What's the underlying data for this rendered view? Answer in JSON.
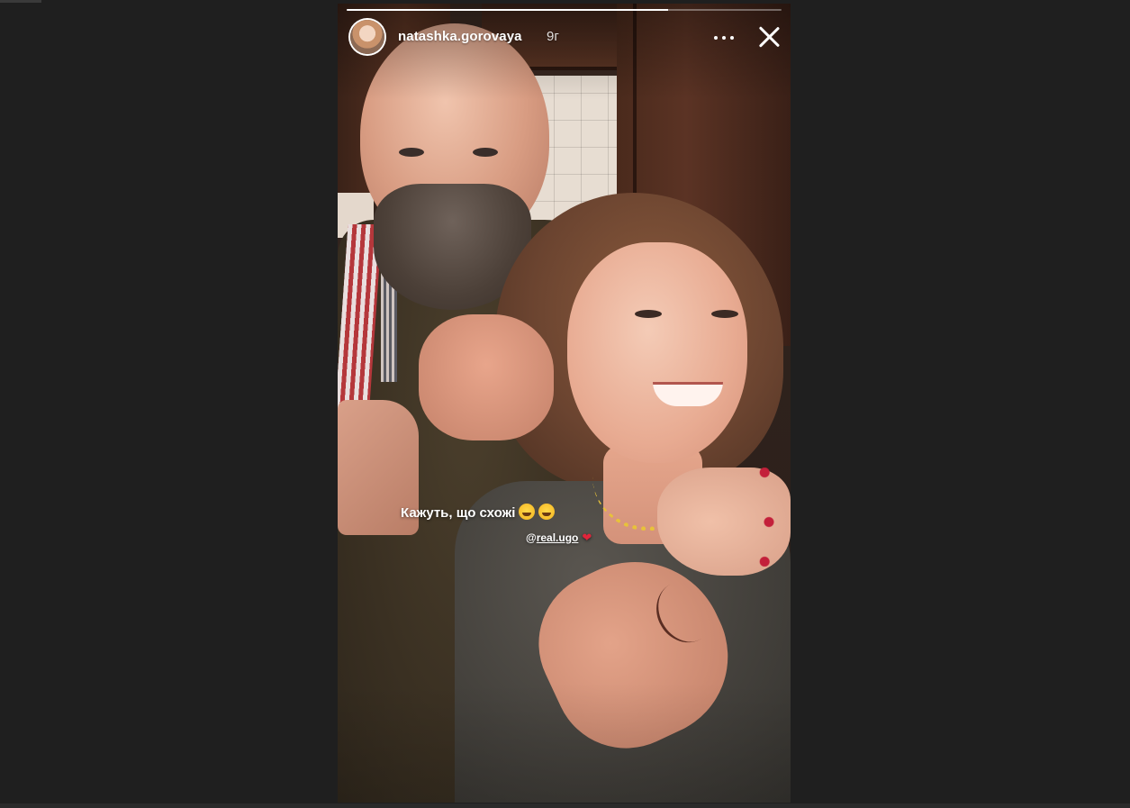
{
  "story": {
    "username": "natashka.gorovaya",
    "time_ago": "9г",
    "progress_fraction": 0.74,
    "caption": "Кажуть, що схожі",
    "caption_emojis": [
      "star-struck-emoji",
      "grinning-emoji"
    ],
    "mention_at": "@",
    "mention_handle": "real.ugo",
    "mention_suffix_icon": "red-heart-icon"
  },
  "colors": {
    "page_background": "#1f1f1f",
    "progress_track": "rgba(255,255,255,0.35)",
    "progress_fill": "#ffffff",
    "text": "#ffffff",
    "heart": "#e0243a"
  }
}
